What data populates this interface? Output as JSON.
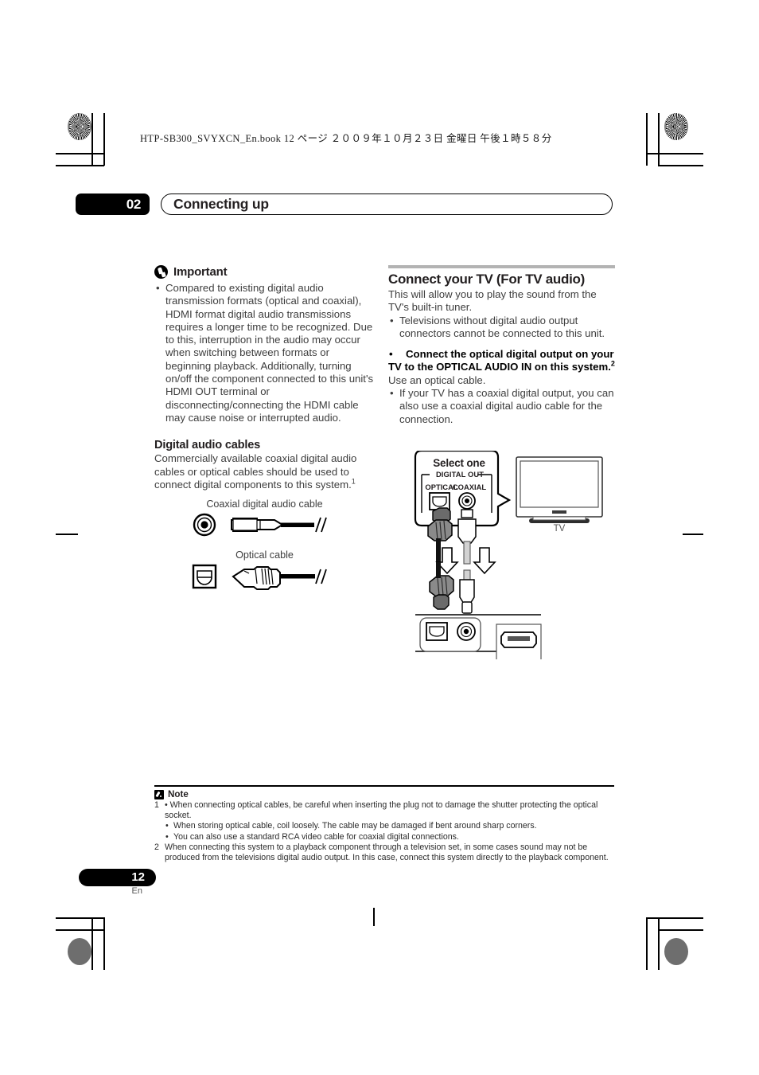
{
  "header": {
    "file_line": "HTP-SB300_SVYXCN_En.book   12 ページ   ２００９年１０月２３日   金曜日   午後１時５８分"
  },
  "chapter": {
    "number": "02",
    "title": "Connecting up"
  },
  "left_column": {
    "important": {
      "icon": "important-hand-icon",
      "title": "Important",
      "bullets": [
        "Compared to existing digital audio transmission formats (optical and coaxial), HDMI format digital audio transmissions requires a longer time to be recognized. Due to this, interruption in the audio may occur when switching between formats or beginning playback. Additionally, turning on/off the component connected to this unit's HDMI OUT terminal or disconnecting/connecting the HDMI cable may cause noise or interrupted audio."
      ]
    },
    "digital_audio_cables": {
      "heading": "Digital audio cables",
      "body": "Commercially available coaxial digital audio cables or optical cables should be used to connect digital components to this system.",
      "body_footnote": "1",
      "figures": [
        {
          "caption": "Coaxial digital audio cable",
          "icon": "coaxial-cable-figure"
        },
        {
          "caption": "Optical cable",
          "icon": "optical-cable-figure"
        }
      ]
    }
  },
  "right_column": {
    "heading": "Connect your TV (For TV audio)",
    "intro": "This will allow you to play the sound from the TV's built-in tuner.",
    "bullets_1": [
      "Televisions without digital audio output connectors cannot be connected to this unit."
    ],
    "instruction_bold": "Connect the optical digital output on your TV to the OPTICAL AUDIO IN on this system.",
    "instruction_footnote": "2",
    "instruction_follow": "Use an optical cable.",
    "bullets_2": [
      "If your TV has a coaxial digital output, you can also use a coaxial digital audio cable for the connection."
    ]
  },
  "diagram": {
    "callout_title": "Select one",
    "panel_group_label": "DIGITAL OUT",
    "jack_optical_label": "OPTICAL",
    "jack_coaxial_label": "COAXIAL",
    "tv_label": "TV",
    "receiver_optical_icon": "optical-input-jack-icon",
    "receiver_coaxial_icon": "coaxial-input-jack-icon",
    "receiver_hdmi_icon": "hdmi-port-icon",
    "arrow_icon": "down-arrow-icon"
  },
  "notes": {
    "icon": "note-pencil-icon",
    "title": "Note",
    "items": [
      {
        "number": "1",
        "text": "When connecting optical cables, be careful when inserting the plug not to damage the shutter protecting the optical socket.",
        "subs": [
          "When storing optical cable, coil loosely. The cable may be damaged if bent around sharp corners.",
          "You can also use a standard RCA video cable for coaxial digital connections."
        ]
      },
      {
        "number": "2",
        "text": "When connecting this system to a playback component through a television set, in some cases sound may not be produced from the televisions digital audio output. In this case, connect this system directly to the playback component.",
        "subs": []
      }
    ]
  },
  "footer": {
    "page_number": "12",
    "language": "En"
  },
  "colors": {
    "ink": "#231f20",
    "gray_rule": "#b3b3b3",
    "body_gray": "#3d3d3d"
  }
}
